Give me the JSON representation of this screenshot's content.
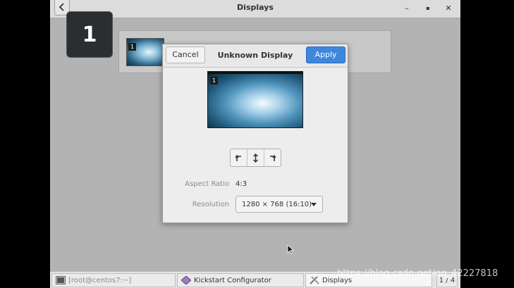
{
  "window": {
    "title": "Displays",
    "back_icon": "chevron-left-icon",
    "minimize_glyph": "–",
    "maximize_glyph": "▪",
    "close_glyph": "✕"
  },
  "monitor_badge": "1",
  "arrangement": {
    "thumbnail_number": "1"
  },
  "dialog": {
    "title": "Unknown Display",
    "cancel_label": "Cancel",
    "apply_label": "Apply",
    "preview_number": "1",
    "rotation": {
      "left_icon": "rotate-left-icon",
      "flip_icon": "flip-vertical-icon",
      "right_icon": "rotate-right-icon"
    },
    "aspect_ratio_label": "Aspect Ratio",
    "aspect_ratio_value": "4:3",
    "resolution_label": "Resolution",
    "resolution_value": "1280 × 768 (16:10)"
  },
  "taskbar": {
    "items": [
      {
        "label": "[root@centos7:~]",
        "icon": "terminal-icon"
      },
      {
        "label": "Kickstart Configurator",
        "icon": "kickstart-icon"
      },
      {
        "label": "Displays",
        "icon": "displays-icon"
      }
    ],
    "pager": "1 / 4"
  },
  "watermark": "https://blog.csdn.net/qq_42227818",
  "colors": {
    "apply_button": "#3f87db",
    "desktop_bg": "#b3b3b3",
    "badge_bg": "#2b2e30"
  }
}
